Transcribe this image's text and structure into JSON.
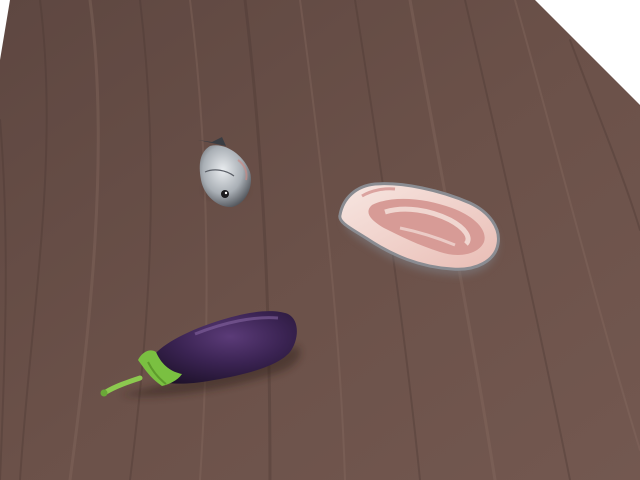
{
  "scene": {
    "background_color": "#ffffff",
    "table": {
      "material": "wood",
      "color": "#6b5149",
      "grain_light": "#8a6e63",
      "grain_dark": "#4a3732"
    },
    "objects": [
      {
        "name": "fish",
        "colors": [
          "#cfd3d6",
          "#6f7378",
          "#2a2a2e"
        ]
      },
      {
        "name": "pork-slice",
        "colors": [
          "#f2d6cf",
          "#c97a78",
          "#8a8c92"
        ]
      },
      {
        "name": "eggplant",
        "colors": [
          "#2c1a3f",
          "#4a2d63",
          "#7ac041"
        ]
      }
    ]
  }
}
